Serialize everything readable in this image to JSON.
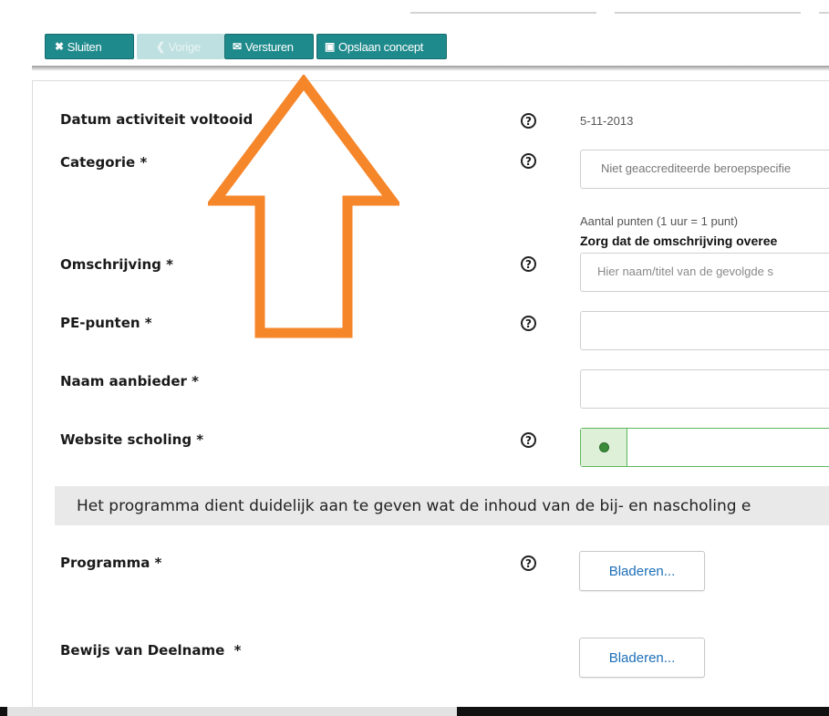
{
  "toolbar": {
    "close_label": "Sluiten",
    "prev_label": "Vorige",
    "send_label": "Versturen",
    "save_label": "Opslaan concept"
  },
  "form": {
    "date_label": "Datum activiteit voltooid",
    "date_value": "5-11-2013",
    "category_label": "Categorie *",
    "category_value": "Niet geaccrediteerde beroepspecifie",
    "points_hint": "Aantal punten (1 uur = 1 punt)",
    "description_hint": "Zorg dat de omschrijving overee",
    "description_label": "Omschrijving *",
    "description_placeholder": "Hier naam/titel van de gevolgde s",
    "pe_label": "PE-punten *",
    "provider_label": "Naam aanbieder *",
    "website_label": "Website scholing *",
    "info_text": "Het programma dient duidelijk aan te geven wat de inhoud van de bij- en nascholing e",
    "program_label": "Programma *",
    "program_browse": "Bladeren...",
    "proof_label": "Bewijs van Deelname  *",
    "proof_browse": "Bladeren..."
  },
  "colors": {
    "toolbar_button": "#1f8a8c",
    "arrow": "#f5862a",
    "link": "#1d6fb8",
    "success_border": "#5cb85c"
  },
  "icons": {
    "close": "close-icon",
    "prev": "chevron-left-icon",
    "send": "envelope-icon",
    "save": "floppy-disk-icon",
    "help": "help-circle-icon",
    "website": "globe-icon",
    "annotation": "arrow-up-icon"
  }
}
